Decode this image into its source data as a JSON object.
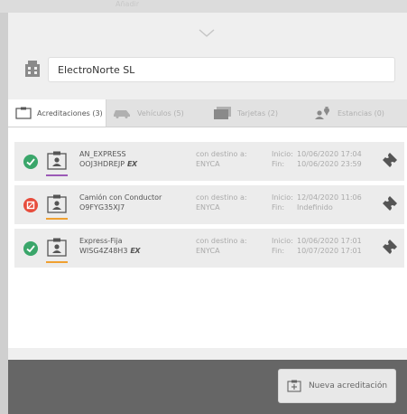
{
  "header": {
    "faded_title": "Añadir"
  },
  "company": {
    "icon": "building-icon",
    "name": "ElectroNorte SL"
  },
  "tabs": [
    {
      "label": "Acreditaciones (3)",
      "icon": "badge-icon",
      "active": true
    },
    {
      "label": "Vehículos (5)",
      "icon": "car-icon",
      "active": false
    },
    {
      "label": "Tarjetas (2)",
      "icon": "card-icon",
      "active": false
    },
    {
      "label": "Estancias (0)",
      "icon": "person-pin-icon",
      "active": false
    }
  ],
  "labels": {
    "destination": "con destino a:",
    "start": "Inicio:",
    "end": "Fin:"
  },
  "accreditations": [
    {
      "status": "valid",
      "status_color": "#3aa66a",
      "bar_color": "#9b59b6",
      "name": "AN_EXPRESS",
      "code": "OOJ3HDREJP",
      "ex_tag": "EX",
      "destination": "ENYCA",
      "start": "10/06/2020 17:04",
      "end": "10/06/2020 23:59"
    },
    {
      "status": "error",
      "status_color": "#e74c3c",
      "bar_color": "#f0a030",
      "name": "Camión con Conductor",
      "code": "O9FYG35XJ7",
      "ex_tag": "",
      "destination": "ENYCA",
      "start": "12/04/2020 11:06",
      "end": "Indefinido"
    },
    {
      "status": "valid",
      "status_color": "#3aa66a",
      "bar_color": "#f0a030",
      "name": "Express-Fija",
      "code": "WISG4Z48H3",
      "ex_tag": "EX",
      "destination": "ENYCA",
      "start": "10/06/2020 17:01",
      "end": "10/07/2020 17:01"
    }
  ],
  "footer": {
    "new_button_label": "Nueva acreditación"
  }
}
